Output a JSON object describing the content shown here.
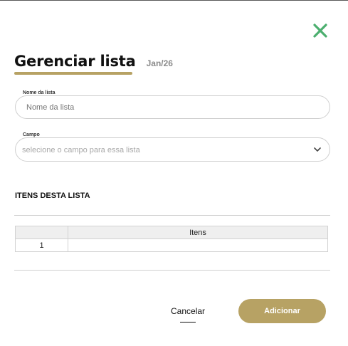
{
  "dialog": {
    "title": "Gerenciar lista",
    "date": "Jan/26"
  },
  "fields": {
    "list_name": {
      "label": "Nome da lista",
      "placeholder": "Nome da lista",
      "value": ""
    },
    "campo": {
      "label": "Campo",
      "placeholder": "selecione o campo para essa lista"
    }
  },
  "section": {
    "title": "ITENS DESTA LISTA"
  },
  "table": {
    "header": "Itens",
    "rows": [
      {
        "index": "1",
        "value": ""
      }
    ]
  },
  "actions": {
    "cancel_label": "Cancelar",
    "add_label": "Adicionar"
  },
  "colors": {
    "accent": "#b7a264",
    "close": "#4caf6f"
  },
  "icons": {
    "close": "close-icon",
    "select": "chevron-down-icon"
  }
}
